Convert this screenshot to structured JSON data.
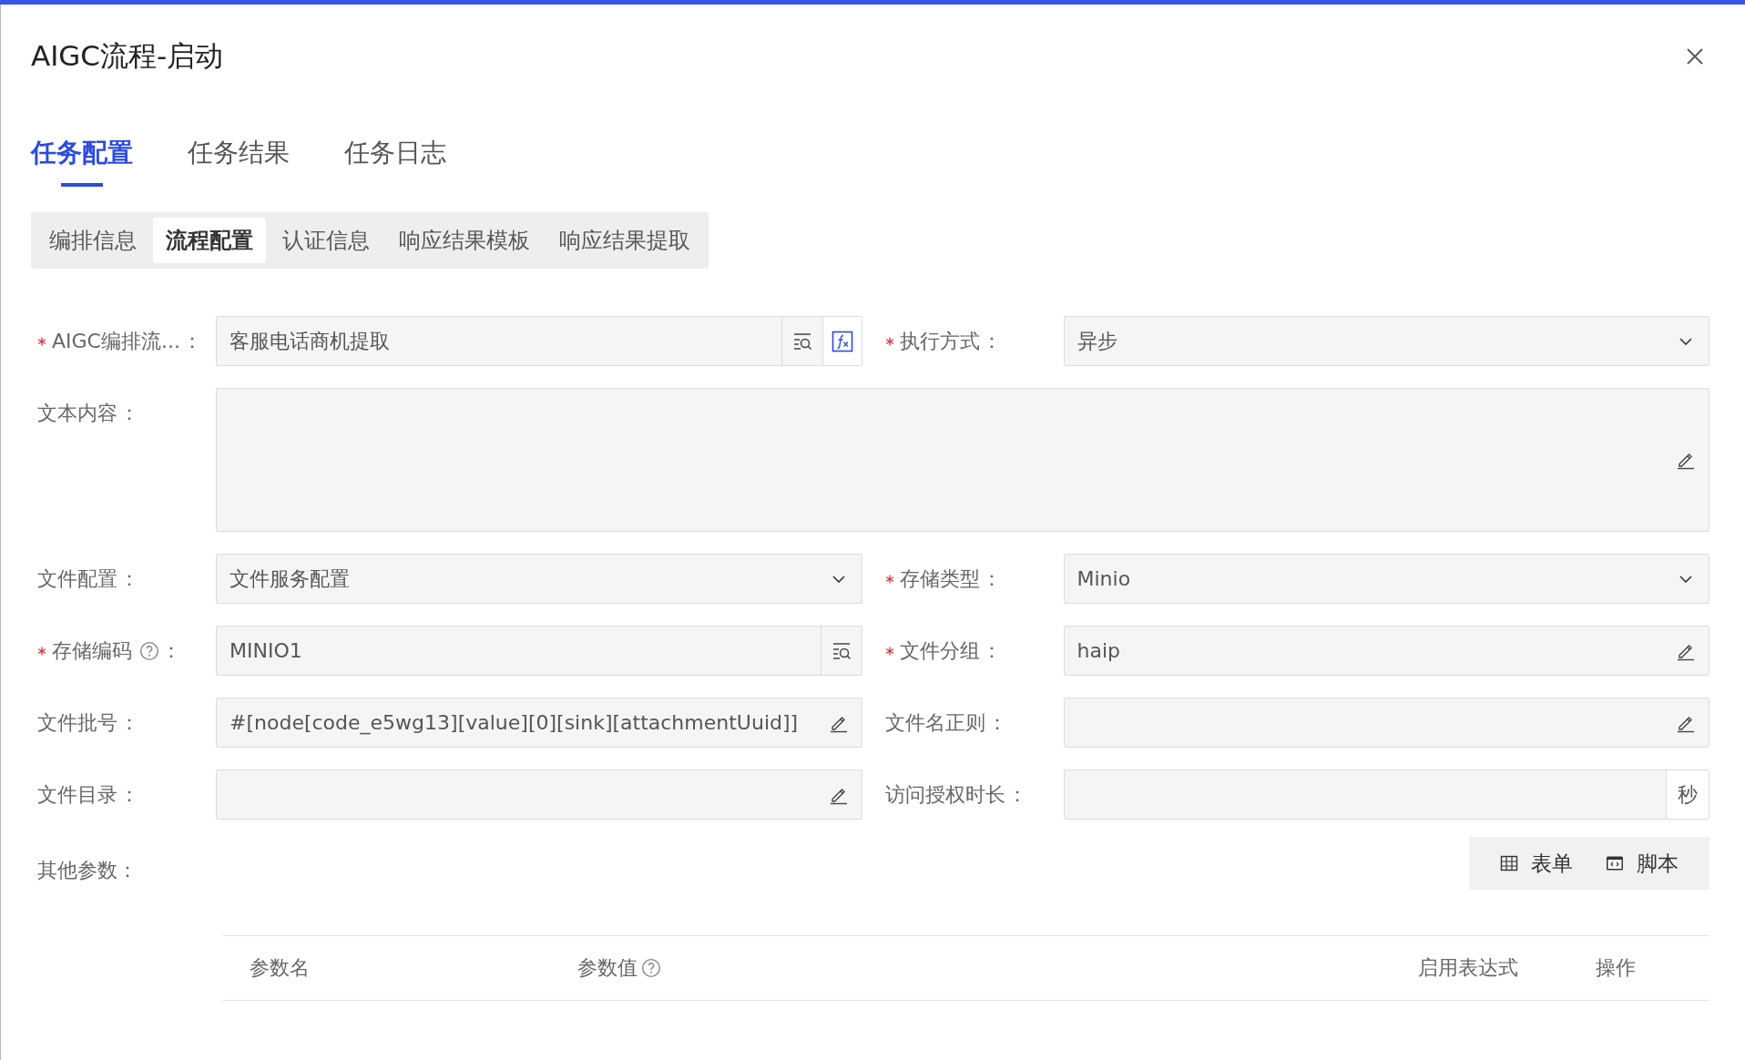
{
  "dialog": {
    "title": "AIGC流程-启动"
  },
  "tabs": [
    {
      "label": "任务配置",
      "selected": true
    },
    {
      "label": "任务结果",
      "selected": false
    },
    {
      "label": "任务日志",
      "selected": false
    }
  ],
  "sub_tabs": [
    {
      "label": "编排信息",
      "selected": false
    },
    {
      "label": "流程配置",
      "selected": true
    },
    {
      "label": "认证信息",
      "selected": false
    },
    {
      "label": "响应结果模板",
      "selected": false
    },
    {
      "label": "响应结果提取",
      "selected": false
    }
  ],
  "form_rows": [
    [
      {
        "label": "AIGC编排流...",
        "colon": "：",
        "required": true,
        "help": false,
        "kind": "input",
        "value": "客服电话商机提取",
        "addons": [
          {
            "kind": "search"
          },
          {
            "kind": "fx"
          }
        ]
      },
      {
        "label": "执行方式",
        "colon": "：",
        "required": true,
        "help": false,
        "kind": "select",
        "value": "异步"
      }
    ],
    [
      {
        "label": "文本内容",
        "colon": "：",
        "required": false,
        "help": false,
        "kind": "textarea",
        "addons": [
          {
            "kind": "edit"
          }
        ]
      }
    ],
    [
      {
        "label": "文件配置",
        "colon": "：",
        "required": false,
        "help": false,
        "kind": "select",
        "value": "文件服务配置"
      },
      {
        "label": "存储类型",
        "colon": "：",
        "required": true,
        "help": false,
        "kind": "select",
        "value": "Minio"
      }
    ],
    [
      {
        "label": "存储编码",
        "colon": "：",
        "required": true,
        "help": true,
        "kind": "input",
        "value": "MINIO1",
        "addons": [
          {
            "kind": "search"
          }
        ]
      },
      {
        "label": "文件分组",
        "colon": "：",
        "required": true,
        "help": false,
        "kind": "input",
        "value": "haip",
        "addons": [
          {
            "kind": "edit"
          }
        ]
      }
    ],
    [
      {
        "label": "文件批号",
        "colon": "：",
        "required": false,
        "help": false,
        "kind": "input",
        "value": "#[node[code_e5wg13][value][0][sink][attachmentUuid]]",
        "addons": [
          {
            "kind": "edit"
          }
        ]
      },
      {
        "label": "文件名正则",
        "colon": "：",
        "required": false,
        "help": false,
        "kind": "input",
        "addons": [
          {
            "kind": "edit"
          }
        ]
      }
    ],
    [
      {
        "label": "文件目录",
        "colon": "：",
        "required": false,
        "help": false,
        "kind": "input",
        "addons": [
          {
            "kind": "edit"
          }
        ]
      },
      {
        "label": "访问授权时长",
        "colon": "：",
        "required": false,
        "help": false,
        "kind": "input",
        "addons": [
          {
            "kind": "unit",
            "text": "秒"
          }
        ]
      }
    ]
  ],
  "other_params": {
    "label": "其他参数：",
    "buttons": [
      {
        "kind": "table",
        "label": "表单"
      },
      {
        "kind": "script",
        "label": "脚本"
      }
    ],
    "columns": [
      {
        "label": "参数名",
        "help": false
      },
      {
        "label": "参数值",
        "help": true
      },
      {
        "label": "启用表达式",
        "help": false
      },
      {
        "label": "操作",
        "help": false
      }
    ]
  }
}
